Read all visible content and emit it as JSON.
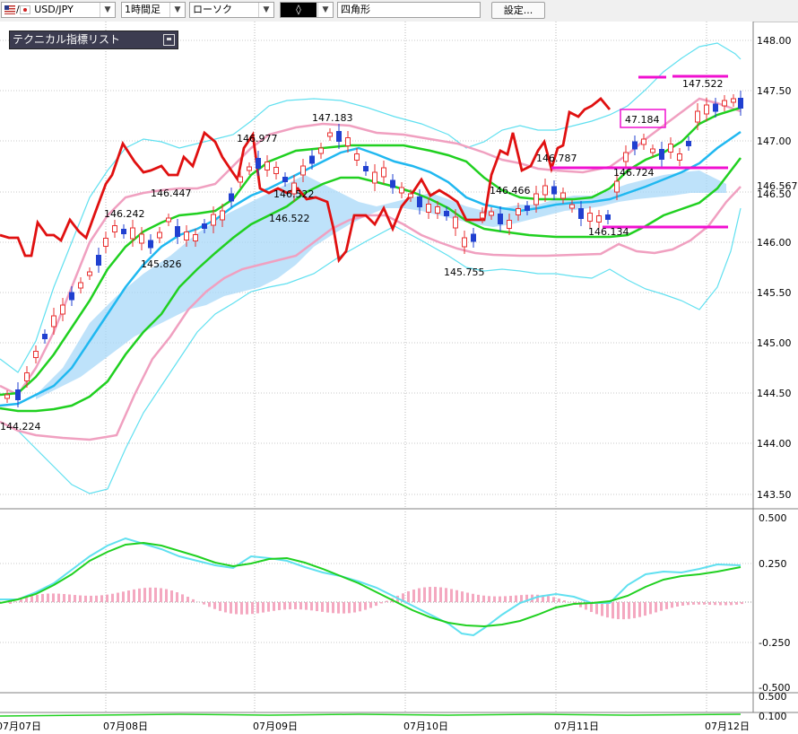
{
  "toolbar": {
    "symbol": "USD/JPY",
    "symbol_sep": "/",
    "timeframe": "1時間足",
    "chart_style": "ローソク",
    "drawing_tool_glyph": "◊",
    "drawing_shape": "四角形",
    "settings_label": "設定..."
  },
  "indicator_panel": {
    "title": "テクニカル指標リスト"
  },
  "colors": {
    "up_candle": "#e83030",
    "down_candle": "#2040d0",
    "bollinger_outer": "#60e0f0",
    "bollinger_inner": "#f0a0c0",
    "ma_short": "#20d020",
    "ma_long": "#20b8f0",
    "cloud": "#a8d8f8",
    "lagging": "#e01010",
    "annotation": "#f010d0"
  },
  "price_axis": {
    "labels": [
      "148.00",
      "147.50",
      "147.00",
      "146.567",
      "146.50",
      "146.00",
      "145.50",
      "145.00",
      "144.50",
      "144.00",
      "143.50"
    ]
  },
  "oscillator_axis": {
    "labels": [
      "0.500",
      "0.250",
      "-0.250",
      "-0.500",
      "0.500",
      "0.100"
    ]
  },
  "date_labels": [
    "07月07日",
    "07月08日",
    "07月09日",
    "07月10日",
    "07月11日",
    "07月12日"
  ],
  "price_labels": [
    "144.224",
    "146.242",
    "146.447",
    "145.826",
    "146.977",
    "146.522",
    "146.522",
    "147.183",
    "145.755",
    "146.466",
    "146.787",
    "146.134",
    "146.724",
    "147.522",
    "47.184"
  ],
  "chart_data": {
    "type": "candlestick",
    "symbol": "USD/JPY",
    "interval": "1時間足",
    "ylim": [
      143.5,
      148.0
    ],
    "x_labels": [
      "07月07日",
      "07月08日",
      "07月09日",
      "07月10日",
      "07月11日",
      "07月12日"
    ],
    "annotations": [
      {
        "text": "144.224",
        "value": 144.224
      },
      {
        "text": "146.242",
        "value": 146.242
      },
      {
        "text": "146.447",
        "value": 146.447
      },
      {
        "text": "145.826",
        "value": 145.826
      },
      {
        "text": "146.977",
        "value": 146.977
      },
      {
        "text": "146.522",
        "value": 146.522
      },
      {
        "text": "147.183",
        "value": 147.183
      },
      {
        "text": "145.755",
        "value": 145.755
      },
      {
        "text": "146.466",
        "value": 146.466
      },
      {
        "text": "146.787",
        "value": 146.787
      },
      {
        "text": "146.134",
        "value": 146.134
      },
      {
        "text": "146.724",
        "value": 146.724
      },
      {
        "text": "147.522",
        "value": 147.522
      }
    ],
    "current_price": 146.567,
    "oscillator": {
      "type": "MACD",
      "ylim": [
        -0.5,
        0.5
      ],
      "ticks": [
        0.5,
        0.25,
        -0.25,
        -0.5
      ]
    }
  }
}
